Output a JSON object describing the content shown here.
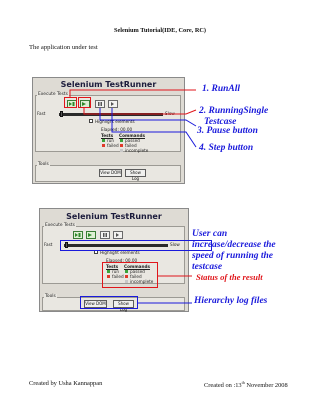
{
  "doc": {
    "title": "Selenium Tutorial(IDE, Core, RC)",
    "intro": "The application under test",
    "footer_left": "Created by Usha Kannappan",
    "footer_right_prefix": "Created on :13",
    "footer_right_sup": "th",
    "footer_right_suffix": " November 2008"
  },
  "runner": {
    "title": "Selenium TestRunner",
    "execute_tests": "Execute Tests",
    "fast": "Fast",
    "slow": "Slow",
    "highlight": "Highlight elements",
    "elapsed": "Elapsed: 00.00",
    "tests": "Tests",
    "commands": "Commands",
    "run": "run",
    "failed": "failed",
    "passed": "passed",
    "failed2": "failed",
    "incomplete": "incomplete",
    "tools": "Tools",
    "view_dom": "View DOM",
    "show_log": "Show Log"
  },
  "annotations1": {
    "a1": "1. RunAll",
    "a2a": "2. RunningSingle",
    "a2b": "Testcase",
    "a3": "3. Pause button",
    "a4": "4. Step button"
  },
  "annotations2": {
    "u1": "User can",
    "u2": "increase/decrease the",
    "u3": "speed of running the",
    "u4": "testcase",
    "status": "Status of the result",
    "hier": "Hierarchy log files"
  },
  "colors": {
    "annotation_blue": "#1a1adb",
    "annotation_red": "#e0161b",
    "passed_green": "#3aa43a",
    "failed_red": "#e03a2a"
  }
}
